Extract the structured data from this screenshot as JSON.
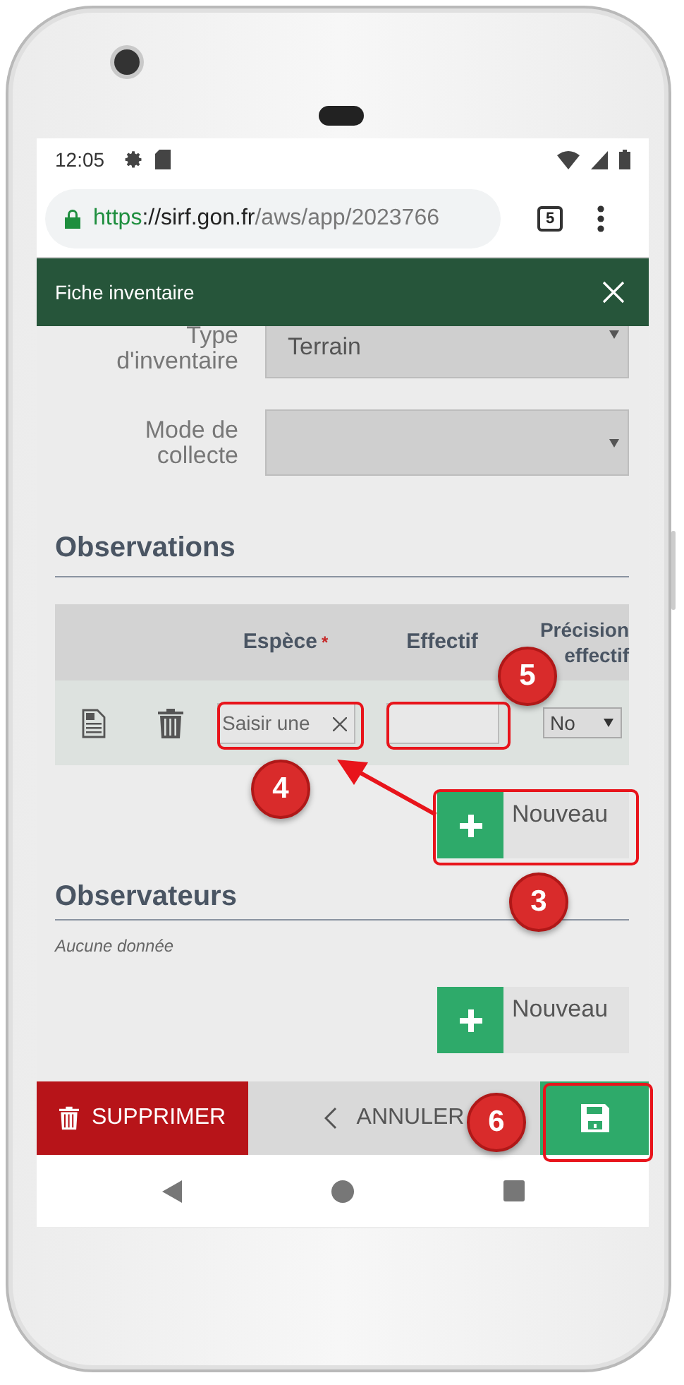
{
  "status_bar": {
    "time": "12:05"
  },
  "browser": {
    "url_parts": [
      {
        "text": "https",
        "kind": "secure"
      },
      {
        "text": "://sirf.gon.fr",
        "kind": "host"
      },
      {
        "text": "/aws/app/2023766",
        "kind": "path"
      }
    ],
    "tab_count": "5"
  },
  "header": {
    "title": "Fiche inventaire"
  },
  "form": {
    "fields": [
      {
        "label": "Type d'inventaire",
        "value": "Terrain"
      },
      {
        "label": "Mode de collecte"
      }
    ]
  },
  "observations": {
    "title": "Observations",
    "columns": [
      {
        "label": "Espèce",
        "required_mark": "*"
      },
      {
        "label": "Effectif"
      },
      {
        "label": "Précision effectif"
      }
    ],
    "rows": [
      {
        "species_placeholder": "Saisir une",
        "precision": "No"
      }
    ],
    "new_button": "Nouveau"
  },
  "observers": {
    "title": "Observateurs",
    "empty_text": "Aucune donnée",
    "new_button": "Nouveau"
  },
  "actions": {
    "delete": "SUPPRIMER",
    "cancel": "ANNULER"
  },
  "callouts": [
    {
      "number": "5"
    },
    {
      "number": "4"
    },
    {
      "number": "3"
    },
    {
      "number": "6"
    }
  ]
}
